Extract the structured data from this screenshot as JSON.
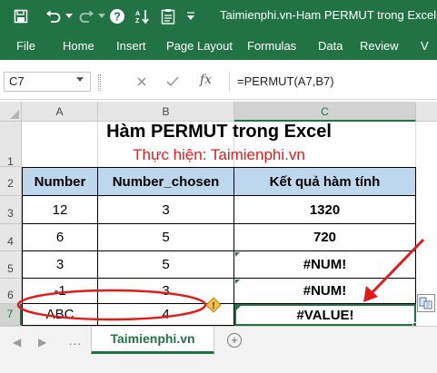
{
  "title_bar": {
    "window_title": "Taimienphi.vn-Ham PERMUT trong Excel.xls",
    "save_icon": "save-icon",
    "undo_icon": "undo-icon",
    "redo_icon": "redo-icon",
    "help_icon": "help-icon",
    "accent_color": "#217346"
  },
  "ribbon": {
    "tabs": [
      "File",
      "Home",
      "Insert",
      "Page Layout",
      "Formulas",
      "Data",
      "Review",
      "V"
    ]
  },
  "formula_bar": {
    "name_box": "C7",
    "fx_label": "fx",
    "formula": "=PERMUT(A7,B7)"
  },
  "sheet": {
    "columns": [
      "A",
      "B",
      "C"
    ],
    "rows": [
      "1",
      "2",
      "3",
      "4",
      "5",
      "6",
      "7"
    ],
    "selected_cell": "C7",
    "title": "Hàm PERMUT trong Excel",
    "subtitle": "Thực hiện: Taimienphi.vn",
    "header_fill": "#bdd7ee",
    "headers": [
      "Number",
      "Number_chosen",
      "Kết quả hàm tính"
    ],
    "data_rows": [
      [
        "12",
        "3",
        "1320"
      ],
      [
        "6",
        "5",
        "720"
      ],
      [
        "3",
        "5",
        "#NUM!"
      ],
      [
        "-1",
        "3",
        "#NUM!"
      ],
      [
        "ABC",
        "4",
        "#VALUE!"
      ]
    ],
    "annotation_color": "#e01b1b",
    "warning_icon": "warning-icon",
    "paste_options_icon": "paste-options-icon"
  },
  "sheet_tabs": {
    "active": "Taimienphi.vn",
    "ellipsis": "...",
    "add_icon": "add-sheet-icon"
  }
}
